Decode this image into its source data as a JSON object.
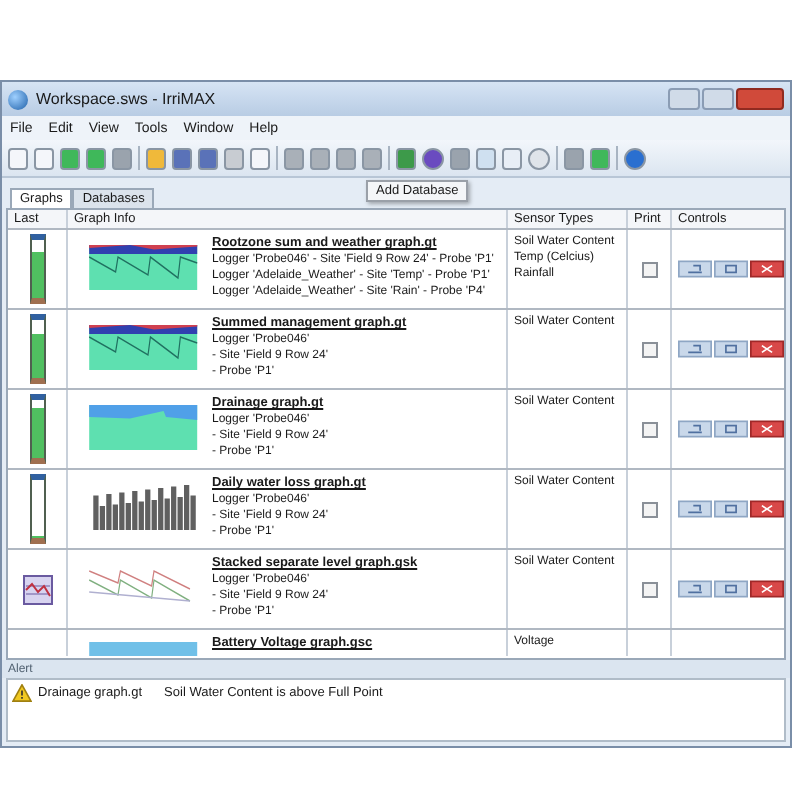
{
  "window": {
    "title": "Workspace.sws - IrriMAX"
  },
  "menu": [
    "File",
    "Edit",
    "View",
    "Tools",
    "Window",
    "Help"
  ],
  "tooltip": "Add Database",
  "tabs": [
    {
      "label": "Graphs",
      "selected": true
    },
    {
      "label": "Databases",
      "selected": false
    }
  ],
  "table": {
    "columns": [
      "Last",
      "Graph Info",
      "Sensor Types",
      "Print",
      "Controls"
    ],
    "rows": [
      {
        "last": {
          "kind": "gauge",
          "level": 0.8
        },
        "thumbnail": {
          "kind": "area"
        },
        "title": "Rootzone sum and weather graph.gt",
        "lines": [
          "Logger 'Probe046' - Site 'Field 9 Row 24' - Probe 'P1'",
          "Logger 'Adelaide_Weather' - Site 'Temp' - Probe 'P1'",
          "Logger 'Adelaide_Weather' - Site 'Rain' - Probe 'P4'"
        ],
        "sensors": [
          "Soil Water Content",
          "Temp (Celcius)",
          "Rainfall"
        ],
        "print": false
      },
      {
        "last": {
          "kind": "gauge",
          "level": 0.75
        },
        "thumbnail": {
          "kind": "area"
        },
        "title": "Summed management graph.gt",
        "lines": [
          "Logger 'Probe046'",
          "- Site 'Field 9 Row 24'",
          "- Probe 'P1'"
        ],
        "sensors": [
          "Soil Water Content"
        ],
        "print": false
      },
      {
        "last": {
          "kind": "gauge",
          "level": 0.85
        },
        "thumbnail": {
          "kind": "band"
        },
        "title": "Drainage graph.gt",
        "lines": [
          "Logger 'Probe046'",
          "- Site 'Field 9 Row 24'",
          "- Probe 'P1'"
        ],
        "sensors": [
          "Soil Water Content"
        ],
        "print": false
      },
      {
        "last": {
          "kind": "gauge",
          "level": 0
        },
        "thumbnail": {
          "kind": "bars"
        },
        "title": "Daily water loss graph.gt",
        "lines": [
          "Logger 'Probe046'",
          "- Site 'Field 9 Row 24'",
          "- Probe 'P1'"
        ],
        "sensors": [
          "Soil Water Content"
        ],
        "print": false
      },
      {
        "last": {
          "kind": "icon"
        },
        "thumbnail": {
          "kind": "lines"
        },
        "title": "Stacked separate level graph.gsk",
        "lines": [
          "Logger 'Probe046'",
          "- Site 'Field 9 Row 24'",
          "- Probe 'P1'"
        ],
        "sensors": [
          "Soil Water Content"
        ],
        "print": false
      },
      {
        "last": {
          "kind": "none"
        },
        "thumbnail": {
          "kind": "strip"
        },
        "title": "Battery Voltage graph.gsc",
        "lines": [],
        "sensors": [
          "Voltage"
        ]
      }
    ]
  },
  "alert": {
    "header": "Alert",
    "items": [
      {
        "source": "Drainage graph.gt",
        "message": "Soil Water Content is above Full Point"
      }
    ]
  }
}
